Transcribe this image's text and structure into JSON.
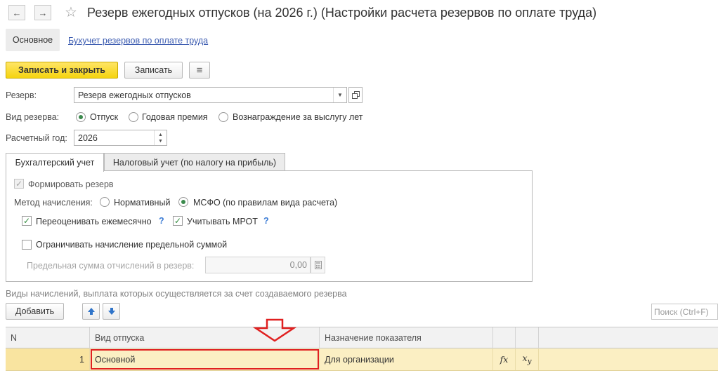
{
  "window": {
    "title": "Резерв ежегодных отпусков (на 2026 г.) (Настройки расчета резервов по оплате труда)",
    "back_icon": "←",
    "forward_icon": "→",
    "star_icon": "☆"
  },
  "sections": {
    "active": "Основное",
    "link": "Бухучет резервов по оплате труда"
  },
  "toolbar": {
    "save_close": "Записать и закрыть",
    "save": "Записать",
    "menu_icon": "≡"
  },
  "form": {
    "reserve_label": "Резерв:",
    "reserve_value": "Резерв ежегодных отпусков",
    "kind_label": "Вид резерва:",
    "kind_options": [
      "Отпуск",
      "Годовая премия",
      "Вознаграждение за выслугу лет"
    ],
    "kind_selected": "Отпуск",
    "year_label": "Расчетный год:",
    "year_value": "2026"
  },
  "tabs": {
    "accounting": "Бухгалтерский учет",
    "tax": "Налоговый учет (по налогу на прибыль)"
  },
  "accounting": {
    "form_reserve": "Формировать резерв",
    "method_label": "Метод начисления:",
    "method_options": [
      "Нормативный",
      "МСФО (по правилам вида расчета)"
    ],
    "method_selected": "МСФО (по правилам вида расчета)",
    "revalue": "Переоценивать ежемесячно",
    "mrot": "Учитывать МРОТ",
    "help": "?",
    "limit": "Ограничивать начисление предельной суммой",
    "limit_sum_label": "Предельная сумма отчислений в резерв:",
    "limit_sum_value": "0,00"
  },
  "table_section": {
    "caption": "Виды начислений, выплата которых осуществляется за счет создаваемого резерва",
    "add_button": "Добавить",
    "search_placeholder": "Поиск (Ctrl+F)"
  },
  "table": {
    "columns": [
      "N",
      "Вид отпуска",
      "Назначение показателя"
    ],
    "rows": [
      {
        "n": "1",
        "kind": "Основной",
        "purpose": "Для организации",
        "fx": "fx",
        "xy": "xy"
      }
    ]
  },
  "colors": {
    "primary_button": "#f5d40f",
    "annotation": "#e02020",
    "selected_row": "#fbefc3"
  }
}
